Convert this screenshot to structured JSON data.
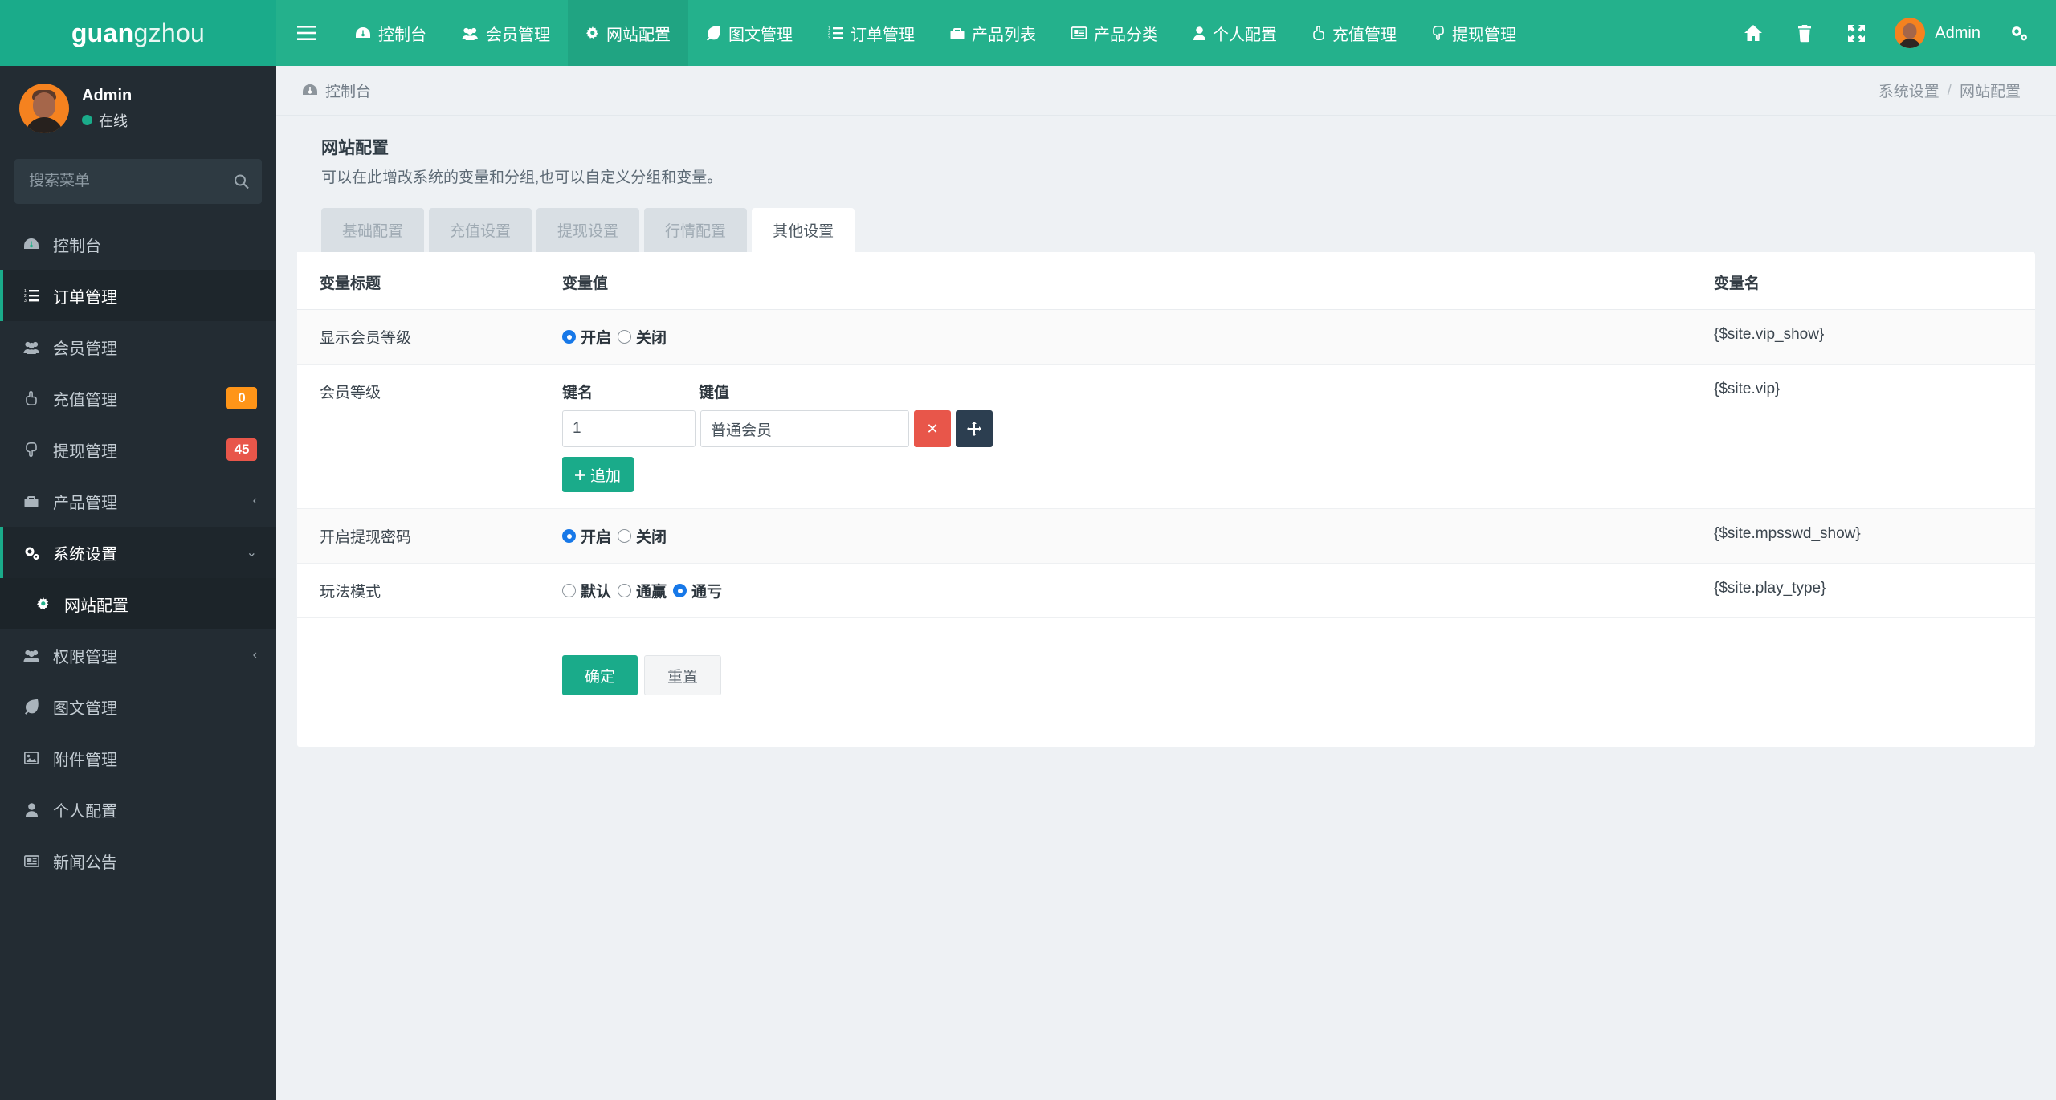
{
  "brand": {
    "bold": "guan",
    "light": "gzhou"
  },
  "topnav": {
    "toggle_icon": "hamburger-icon",
    "items": [
      {
        "label": "控制台",
        "icon": "dashboard-icon",
        "active": false
      },
      {
        "label": "会员管理",
        "icon": "users-icon",
        "active": false
      },
      {
        "label": "网站配置",
        "icon": "gear-icon",
        "active": true
      },
      {
        "label": "图文管理",
        "icon": "leaf-icon",
        "active": false
      },
      {
        "label": "订单管理",
        "icon": "list-ol-icon",
        "active": false
      },
      {
        "label": "产品列表",
        "icon": "briefcase-icon",
        "active": false
      },
      {
        "label": "产品分类",
        "icon": "id-card-icon",
        "active": false
      },
      {
        "label": "个人配置",
        "icon": "user-icon",
        "active": false
      },
      {
        "label": "充值管理",
        "icon": "hand-up-icon",
        "active": false
      },
      {
        "label": "提现管理",
        "icon": "hand-down-icon",
        "active": false
      }
    ],
    "right_icons": [
      "home-icon",
      "trash-icon",
      "fullscreen-icon"
    ],
    "user": {
      "name": "Admin",
      "avatar": "avatar"
    },
    "settings_icon": "gears-icon"
  },
  "sidebar": {
    "user": {
      "name": "Admin",
      "status": "在线"
    },
    "search": {
      "placeholder": "搜索菜单",
      "value": "",
      "icon": "search-icon"
    },
    "items": [
      {
        "label": "控制台",
        "icon": "dashboard-icon",
        "active": false,
        "badge": null,
        "caret": null
      },
      {
        "label": "订单管理",
        "icon": "list-ol-icon",
        "active": true,
        "badge": null,
        "caret": null
      },
      {
        "label": "会员管理",
        "icon": "users-icon",
        "active": false,
        "badge": null,
        "caret": null
      },
      {
        "label": "充值管理",
        "icon": "hand-up-icon",
        "active": false,
        "badge": "0",
        "badge_color": "#ff9518",
        "caret": null
      },
      {
        "label": "提现管理",
        "icon": "hand-down-icon",
        "active": false,
        "badge": "45",
        "badge_color": "#e8564a",
        "caret": null
      },
      {
        "label": "产品管理",
        "icon": "briefcase-icon",
        "active": false,
        "badge": null,
        "caret": "‹"
      },
      {
        "label": "系统设置",
        "icon": "gears-icon",
        "active": true,
        "badge": null,
        "caret": "⌄"
      },
      {
        "label": "网站配置",
        "icon": "gear-icon",
        "sub": true,
        "badge": null,
        "caret": null
      },
      {
        "label": "权限管理",
        "icon": "users-icon",
        "active": false,
        "badge": null,
        "caret": "‹"
      },
      {
        "label": "图文管理",
        "icon": "leaf-icon",
        "active": false,
        "badge": null,
        "caret": null
      },
      {
        "label": "附件管理",
        "icon": "image-icon",
        "active": false,
        "badge": null,
        "caret": null
      },
      {
        "label": "个人配置",
        "icon": "user-icon",
        "active": false,
        "badge": null,
        "caret": null
      },
      {
        "label": "新闻公告",
        "icon": "newspaper-icon",
        "active": false,
        "badge": null,
        "caret": null
      }
    ]
  },
  "breadcrumb": {
    "home_icon": "dashboard-icon",
    "home_label": "控制台",
    "right": [
      "系统设置",
      "网站配置"
    ],
    "separator": "/"
  },
  "page": {
    "title": "网站配置",
    "subtitle": "可以在此增改系统的变量和分组,也可以自定义分组和变量。",
    "tabs": [
      {
        "label": "基础配置",
        "active": false
      },
      {
        "label": "充值设置",
        "active": false
      },
      {
        "label": "提现设置",
        "active": false
      },
      {
        "label": "行情配置",
        "active": false
      },
      {
        "label": "其他设置",
        "active": true
      }
    ],
    "table": {
      "headers": [
        "变量标题",
        "变量值",
        "变量名"
      ],
      "rows": [
        {
          "title": "显示会员等级",
          "type": "radio",
          "options": [
            {
              "label": "开启",
              "selected": true
            },
            {
              "label": "关闭",
              "selected": false
            }
          ],
          "varname": "{$site.vip_show}"
        },
        {
          "title": "会员等级",
          "type": "keyvalue",
          "kv_headers": [
            "键名",
            "键值"
          ],
          "kv_rows": [
            {
              "key": "1",
              "value": "普通会员",
              "key_placeholder": "",
              "value_placeholder": ""
            }
          ],
          "delete_label": "✕",
          "move_label": "move",
          "add_label": "追加",
          "varname": "{$site.vip}"
        },
        {
          "title": "开启提现密码",
          "type": "radio",
          "options": [
            {
              "label": "开启",
              "selected": true
            },
            {
              "label": "关闭",
              "selected": false
            }
          ],
          "varname": "{$site.mpsswd_show}"
        },
        {
          "title": "玩法模式",
          "type": "radio",
          "options": [
            {
              "label": "默认",
              "selected": false
            },
            {
              "label": "通赢",
              "selected": false
            },
            {
              "label": "通亏",
              "selected": true
            }
          ],
          "varname": "{$site.play_type}"
        }
      ]
    },
    "actions": {
      "submit": "确定",
      "reset": "重置"
    }
  },
  "colors": {
    "brand_green": "#1aab8a",
    "topnav_green": "#24b18c",
    "sidebar_dark": "#232c33",
    "badge_orange": "#ff9518",
    "badge_red": "#e8564a",
    "radio_blue": "#1778e8"
  }
}
